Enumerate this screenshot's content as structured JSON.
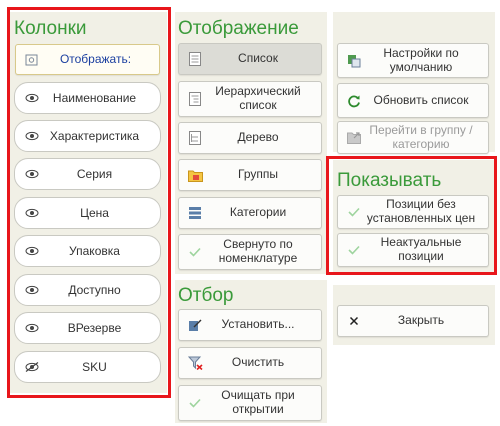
{
  "columns": {
    "heading": "Колонки",
    "display_button": "Отображать:",
    "items": [
      {
        "label": "Наименование",
        "icon": "eye-icon"
      },
      {
        "label": "Характеристика",
        "icon": "eye-icon"
      },
      {
        "label": "Серия",
        "icon": "eye-icon"
      },
      {
        "label": "Цена",
        "icon": "eye-icon"
      },
      {
        "label": "Упаковка",
        "icon": "eye-icon"
      },
      {
        "label": "Доступно",
        "icon": "eye-icon"
      },
      {
        "label": "ВРезерве",
        "icon": "eye-icon"
      },
      {
        "label": "SKU",
        "icon": "eye-slash-icon"
      }
    ]
  },
  "display": {
    "heading": "Отображение",
    "list": "Список",
    "hierarchical_list": "Иерархический список",
    "tree": "Дерево",
    "groups": "Группы",
    "categories": "Категории",
    "collapsed": "Свернуто по номенклатуре"
  },
  "filter": {
    "heading": "Отбор",
    "set": "Установить...",
    "clear": "Очистить",
    "clear_on_open": "Очищать при открытии"
  },
  "actions": {
    "defaults": "Настройки по умолчанию",
    "refresh": "Обновить список",
    "go_to_group": "Перейти в группу / категорию"
  },
  "show": {
    "heading": "Показывать",
    "no_prices": "Позиции без установленных цен",
    "outdated": "Неактуальные позиции"
  },
  "close": "Закрыть",
  "colors": {
    "accent_green": "#3a9a3a",
    "highlight_red": "#e8161b",
    "panel_bg": "#f1f0e6"
  }
}
